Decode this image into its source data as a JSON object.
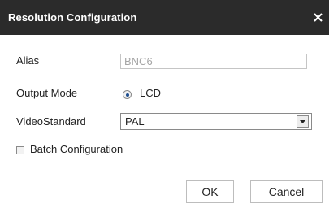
{
  "dialog": {
    "title": "Resolution Configuration",
    "close_icon": "close-icon"
  },
  "form": {
    "alias_label": "Alias",
    "alias_value": "BNC6",
    "output_mode_label": "Output Mode",
    "output_mode_option": "LCD",
    "output_mode_selected": true,
    "video_standard_label": "VideoStandard",
    "video_standard_value": "PAL",
    "batch_label": "Batch Configuration",
    "batch_checked": false
  },
  "buttons": {
    "ok_label": "OK",
    "cancel_label": "Cancel"
  },
  "colors": {
    "titlebar_bg": "#2b2b2b",
    "title_text": "#ffffff",
    "alias_text": "#a6a6a6",
    "radio_dot": "#1f4f8f"
  }
}
